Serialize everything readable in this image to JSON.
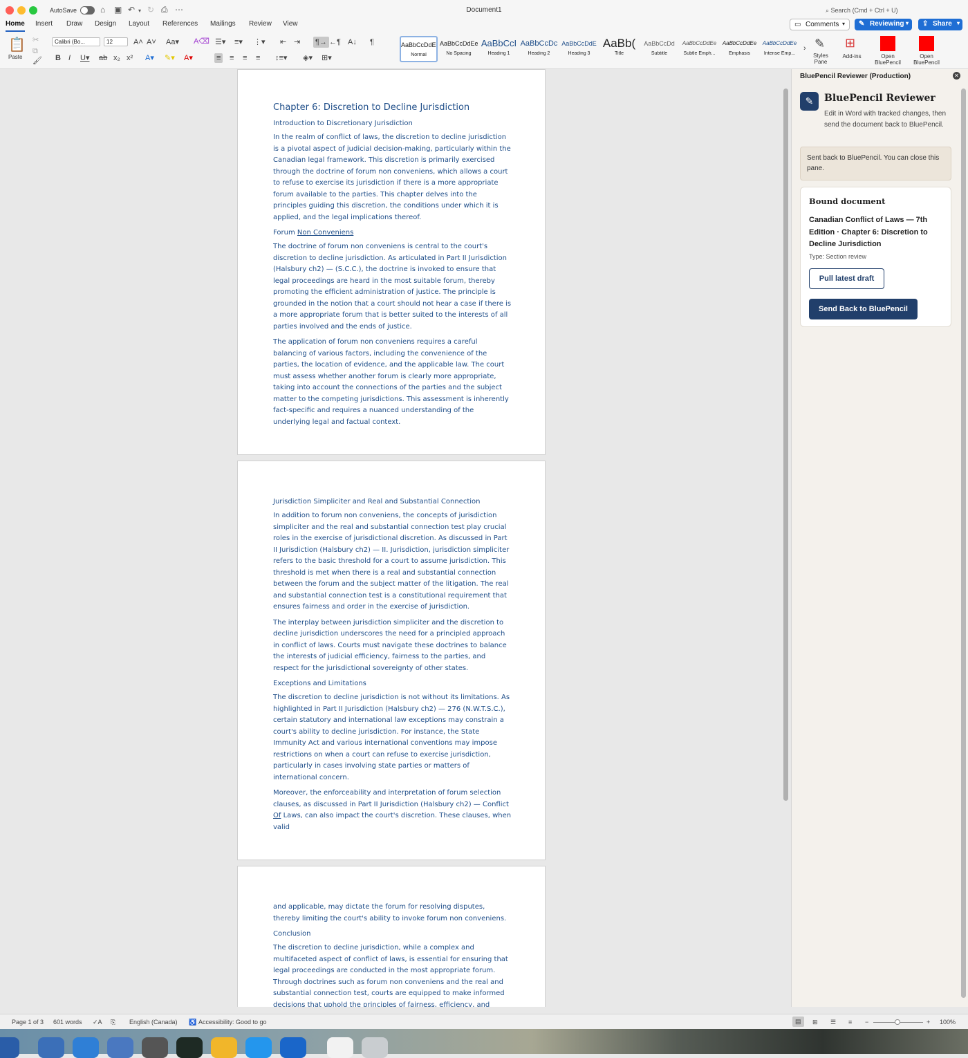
{
  "window": {
    "autosave_label": "AutoSave",
    "doc_title": "Document1",
    "search_placeholder": "Search (Cmd + Ctrl + U)"
  },
  "tabs": [
    "Home",
    "Insert",
    "Draw",
    "Design",
    "Layout",
    "References",
    "Mailings",
    "Review",
    "View"
  ],
  "actions": {
    "comments": "Comments",
    "reviewing": "Reviewing",
    "share": "Share"
  },
  "ribbon": {
    "paste": "Paste",
    "font_name": "Calibri (Bo...",
    "font_size": "12",
    "styles": [
      {
        "sample": "AaBbCcDdEe",
        "name": "Normal"
      },
      {
        "sample": "AaBbCcDdEe",
        "name": "No Spacing"
      },
      {
        "sample": "AaBbCcI",
        "name": "Heading 1"
      },
      {
        "sample": "AaBbCcDc",
        "name": "Heading 2"
      },
      {
        "sample": "AaBbCcDdE",
        "name": "Heading 3"
      },
      {
        "sample": "AaBb(",
        "name": "Title"
      },
      {
        "sample": "AaBbCcDd",
        "name": "Subtitle"
      },
      {
        "sample": "AaBbCcDdEe",
        "name": "Subtle Emph..."
      },
      {
        "sample": "AaBbCcDdEe",
        "name": "Emphasis"
      },
      {
        "sample": "AaBbCcDdEe",
        "name": "Intense Emp..."
      }
    ],
    "styles_pane": "Styles Pane",
    "addins": "Add-ins",
    "open_bp_1": "Open BluePencil",
    "open_bp_2": "Open BluePencil"
  },
  "document": {
    "chapter_title": "Chapter 6: Discretion to Decline Jurisdiction",
    "h_intro": "Introduction to Discretionary Jurisdiction",
    "p_intro": "In the realm of conflict of laws, the discretion to decline jurisdiction is a pivotal aspect of judicial decision-making, particularly within the Canadian legal framework. This discretion is primarily exercised through the doctrine of forum non conveniens, which allows a court to refuse to exercise its jurisdiction if there is a more appropriate forum available to the parties. This chapter delves into the principles guiding this discretion, the conditions under which it is applied, and the legal implications thereof.",
    "h_fnc_a": "Forum ",
    "h_fnc_b": "Non Conveniens",
    "p_fnc1": "The doctrine of forum non conveniens is central to the court's discretion to decline jurisdiction. As articulated in Part II Jurisdiction (Halsbury ch2) — (S.C.C.), the doctrine is invoked to ensure that legal proceedings are heard in the most suitable forum, thereby promoting the efficient administration of justice. The principle is grounded in the notion that a court should not hear a case if there is a more appropriate forum that is better suited to the interests of all parties involved and the ends of justice.",
    "p_fnc2": "The application of forum non conveniens requires a careful balancing of various factors, including the convenience of the parties, the location of evidence, and the applicable law. The court must assess whether another forum is clearly more appropriate, taking into account the connections of the parties and the subject matter to the competing jurisdictions. This assessment is inherently fact-specific and requires a nuanced understanding of the underlying legal and factual context.",
    "h_simp": "Jurisdiction Simpliciter and Real and Substantial Connection",
    "p_simp1": "In addition to forum non conveniens, the concepts of jurisdiction simpliciter and the real and substantial connection test play crucial roles in the exercise of jurisdictional discretion. As discussed in Part II Jurisdiction (Halsbury ch2) — II. Jurisdiction, jurisdiction simpliciter refers to the basic threshold for a court to assume jurisdiction. This threshold is met when there is a real and substantial connection between the forum and the subject matter of the litigation. The real and substantial connection test is a constitutional requirement that ensures fairness and order in the exercise of jurisdiction.",
    "p_simp2": "The interplay between jurisdiction simpliciter and the discretion to decline jurisdiction underscores the need for a principled approach in conflict of laws. Courts must navigate these doctrines to balance the interests of judicial efficiency, fairness to the parties, and respect for the jurisdictional sovereignty of other states.",
    "h_exc": "Exceptions and Limitations",
    "p_exc1": "The discretion to decline jurisdiction is not without its limitations. As highlighted in Part II Jurisdiction (Halsbury ch2) — 276 (N.W.T.S.C.), certain statutory and international law exceptions may constrain a court's ability to decline jurisdiction. For instance, the State Immunity Act and various international conventions may impose restrictions on when a court can refuse to exercise jurisdiction, particularly in cases involving state parties or matters of international concern.",
    "p_exc2_a": "Moreover, the enforceability and interpretation of forum selection clauses, as discussed in Part II Jurisdiction (Halsbury ch2) — Conflict ",
    "p_exc2_b": "Of",
    "p_exc2_c": " Laws, can also impact the court's discretion. These clauses, when valid",
    "p_exc2_cont": "and applicable, may dictate the forum for resolving disputes, thereby limiting the court's ability to invoke forum non conveniens.",
    "h_concl": "Conclusion",
    "p_concl": "The discretion to decline jurisdiction, while a complex and multifaceted aspect of conflict of laws, is essential for ensuring that legal proceedings are conducted in the most appropriate forum. Through doctrines such as forum non conveniens and the real and substantial connection test, courts are equipped to make informed decisions that uphold the principles of fairness, efficiency, and respect for international legal"
  },
  "pane": {
    "title": "BluePencil Reviewer (Production)",
    "heading": "BluePencil Reviewer",
    "subtitle": "Edit in Word with tracked changes, then send the document back to BluePencil.",
    "notice": "Sent back to BluePencil. You can close this pane.",
    "card_heading": "Bound document",
    "doc_name": "Canadian Conflict of Laws — 7th Edition · Chapter 6: Discretion to Decline Jurisdiction",
    "doc_type": "Type: Section review",
    "pull_label": "Pull latest draft",
    "send_label": "Send Back to BluePencil"
  },
  "status": {
    "page": "Page 1 of 3",
    "words": "601 words",
    "language": "English (Canada)",
    "accessibility": "Accessibility: Good to go",
    "zoom": "100%"
  },
  "colors": {
    "accent": "#1f6ed4",
    "doc_text": "#1f4e89",
    "pane_primary": "#213f6b",
    "bluepencil_red": "#ff0000"
  }
}
